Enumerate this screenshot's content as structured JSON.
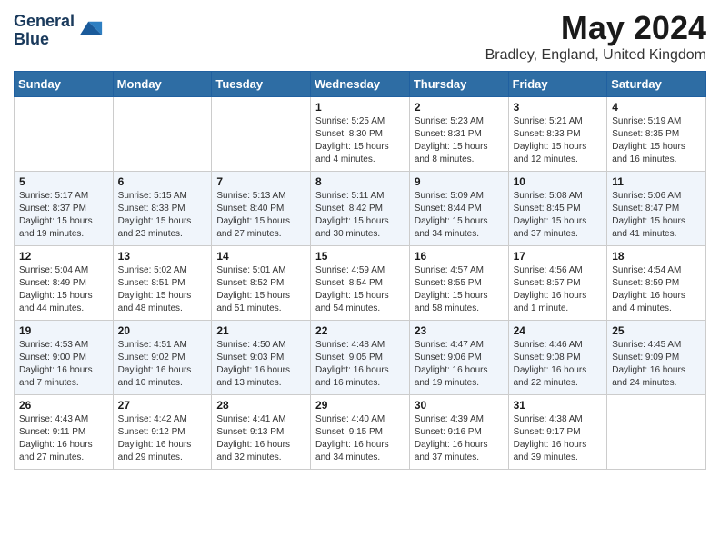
{
  "logo": {
    "line1": "General",
    "line2": "Blue"
  },
  "title": "May 2024",
  "location": "Bradley, England, United Kingdom",
  "days_of_week": [
    "Sunday",
    "Monday",
    "Tuesday",
    "Wednesday",
    "Thursday",
    "Friday",
    "Saturday"
  ],
  "weeks": [
    [
      {
        "day": "",
        "info": ""
      },
      {
        "day": "",
        "info": ""
      },
      {
        "day": "",
        "info": ""
      },
      {
        "day": "1",
        "info": "Sunrise: 5:25 AM\nSunset: 8:30 PM\nDaylight: 15 hours and 4 minutes."
      },
      {
        "day": "2",
        "info": "Sunrise: 5:23 AM\nSunset: 8:31 PM\nDaylight: 15 hours and 8 minutes."
      },
      {
        "day": "3",
        "info": "Sunrise: 5:21 AM\nSunset: 8:33 PM\nDaylight: 15 hours and 12 minutes."
      },
      {
        "day": "4",
        "info": "Sunrise: 5:19 AM\nSunset: 8:35 PM\nDaylight: 15 hours and 16 minutes."
      }
    ],
    [
      {
        "day": "5",
        "info": "Sunrise: 5:17 AM\nSunset: 8:37 PM\nDaylight: 15 hours and 19 minutes."
      },
      {
        "day": "6",
        "info": "Sunrise: 5:15 AM\nSunset: 8:38 PM\nDaylight: 15 hours and 23 minutes."
      },
      {
        "day": "7",
        "info": "Sunrise: 5:13 AM\nSunset: 8:40 PM\nDaylight: 15 hours and 27 minutes."
      },
      {
        "day": "8",
        "info": "Sunrise: 5:11 AM\nSunset: 8:42 PM\nDaylight: 15 hours and 30 minutes."
      },
      {
        "day": "9",
        "info": "Sunrise: 5:09 AM\nSunset: 8:44 PM\nDaylight: 15 hours and 34 minutes."
      },
      {
        "day": "10",
        "info": "Sunrise: 5:08 AM\nSunset: 8:45 PM\nDaylight: 15 hours and 37 minutes."
      },
      {
        "day": "11",
        "info": "Sunrise: 5:06 AM\nSunset: 8:47 PM\nDaylight: 15 hours and 41 minutes."
      }
    ],
    [
      {
        "day": "12",
        "info": "Sunrise: 5:04 AM\nSunset: 8:49 PM\nDaylight: 15 hours and 44 minutes."
      },
      {
        "day": "13",
        "info": "Sunrise: 5:02 AM\nSunset: 8:51 PM\nDaylight: 15 hours and 48 minutes."
      },
      {
        "day": "14",
        "info": "Sunrise: 5:01 AM\nSunset: 8:52 PM\nDaylight: 15 hours and 51 minutes."
      },
      {
        "day": "15",
        "info": "Sunrise: 4:59 AM\nSunset: 8:54 PM\nDaylight: 15 hours and 54 minutes."
      },
      {
        "day": "16",
        "info": "Sunrise: 4:57 AM\nSunset: 8:55 PM\nDaylight: 15 hours and 58 minutes."
      },
      {
        "day": "17",
        "info": "Sunrise: 4:56 AM\nSunset: 8:57 PM\nDaylight: 16 hours and 1 minute."
      },
      {
        "day": "18",
        "info": "Sunrise: 4:54 AM\nSunset: 8:59 PM\nDaylight: 16 hours and 4 minutes."
      }
    ],
    [
      {
        "day": "19",
        "info": "Sunrise: 4:53 AM\nSunset: 9:00 PM\nDaylight: 16 hours and 7 minutes."
      },
      {
        "day": "20",
        "info": "Sunrise: 4:51 AM\nSunset: 9:02 PM\nDaylight: 16 hours and 10 minutes."
      },
      {
        "day": "21",
        "info": "Sunrise: 4:50 AM\nSunset: 9:03 PM\nDaylight: 16 hours and 13 minutes."
      },
      {
        "day": "22",
        "info": "Sunrise: 4:48 AM\nSunset: 9:05 PM\nDaylight: 16 hours and 16 minutes."
      },
      {
        "day": "23",
        "info": "Sunrise: 4:47 AM\nSunset: 9:06 PM\nDaylight: 16 hours and 19 minutes."
      },
      {
        "day": "24",
        "info": "Sunrise: 4:46 AM\nSunset: 9:08 PM\nDaylight: 16 hours and 22 minutes."
      },
      {
        "day": "25",
        "info": "Sunrise: 4:45 AM\nSunset: 9:09 PM\nDaylight: 16 hours and 24 minutes."
      }
    ],
    [
      {
        "day": "26",
        "info": "Sunrise: 4:43 AM\nSunset: 9:11 PM\nDaylight: 16 hours and 27 minutes."
      },
      {
        "day": "27",
        "info": "Sunrise: 4:42 AM\nSunset: 9:12 PM\nDaylight: 16 hours and 29 minutes."
      },
      {
        "day": "28",
        "info": "Sunrise: 4:41 AM\nSunset: 9:13 PM\nDaylight: 16 hours and 32 minutes."
      },
      {
        "day": "29",
        "info": "Sunrise: 4:40 AM\nSunset: 9:15 PM\nDaylight: 16 hours and 34 minutes."
      },
      {
        "day": "30",
        "info": "Sunrise: 4:39 AM\nSunset: 9:16 PM\nDaylight: 16 hours and 37 minutes."
      },
      {
        "day": "31",
        "info": "Sunrise: 4:38 AM\nSunset: 9:17 PM\nDaylight: 16 hours and 39 minutes."
      },
      {
        "day": "",
        "info": ""
      }
    ]
  ]
}
